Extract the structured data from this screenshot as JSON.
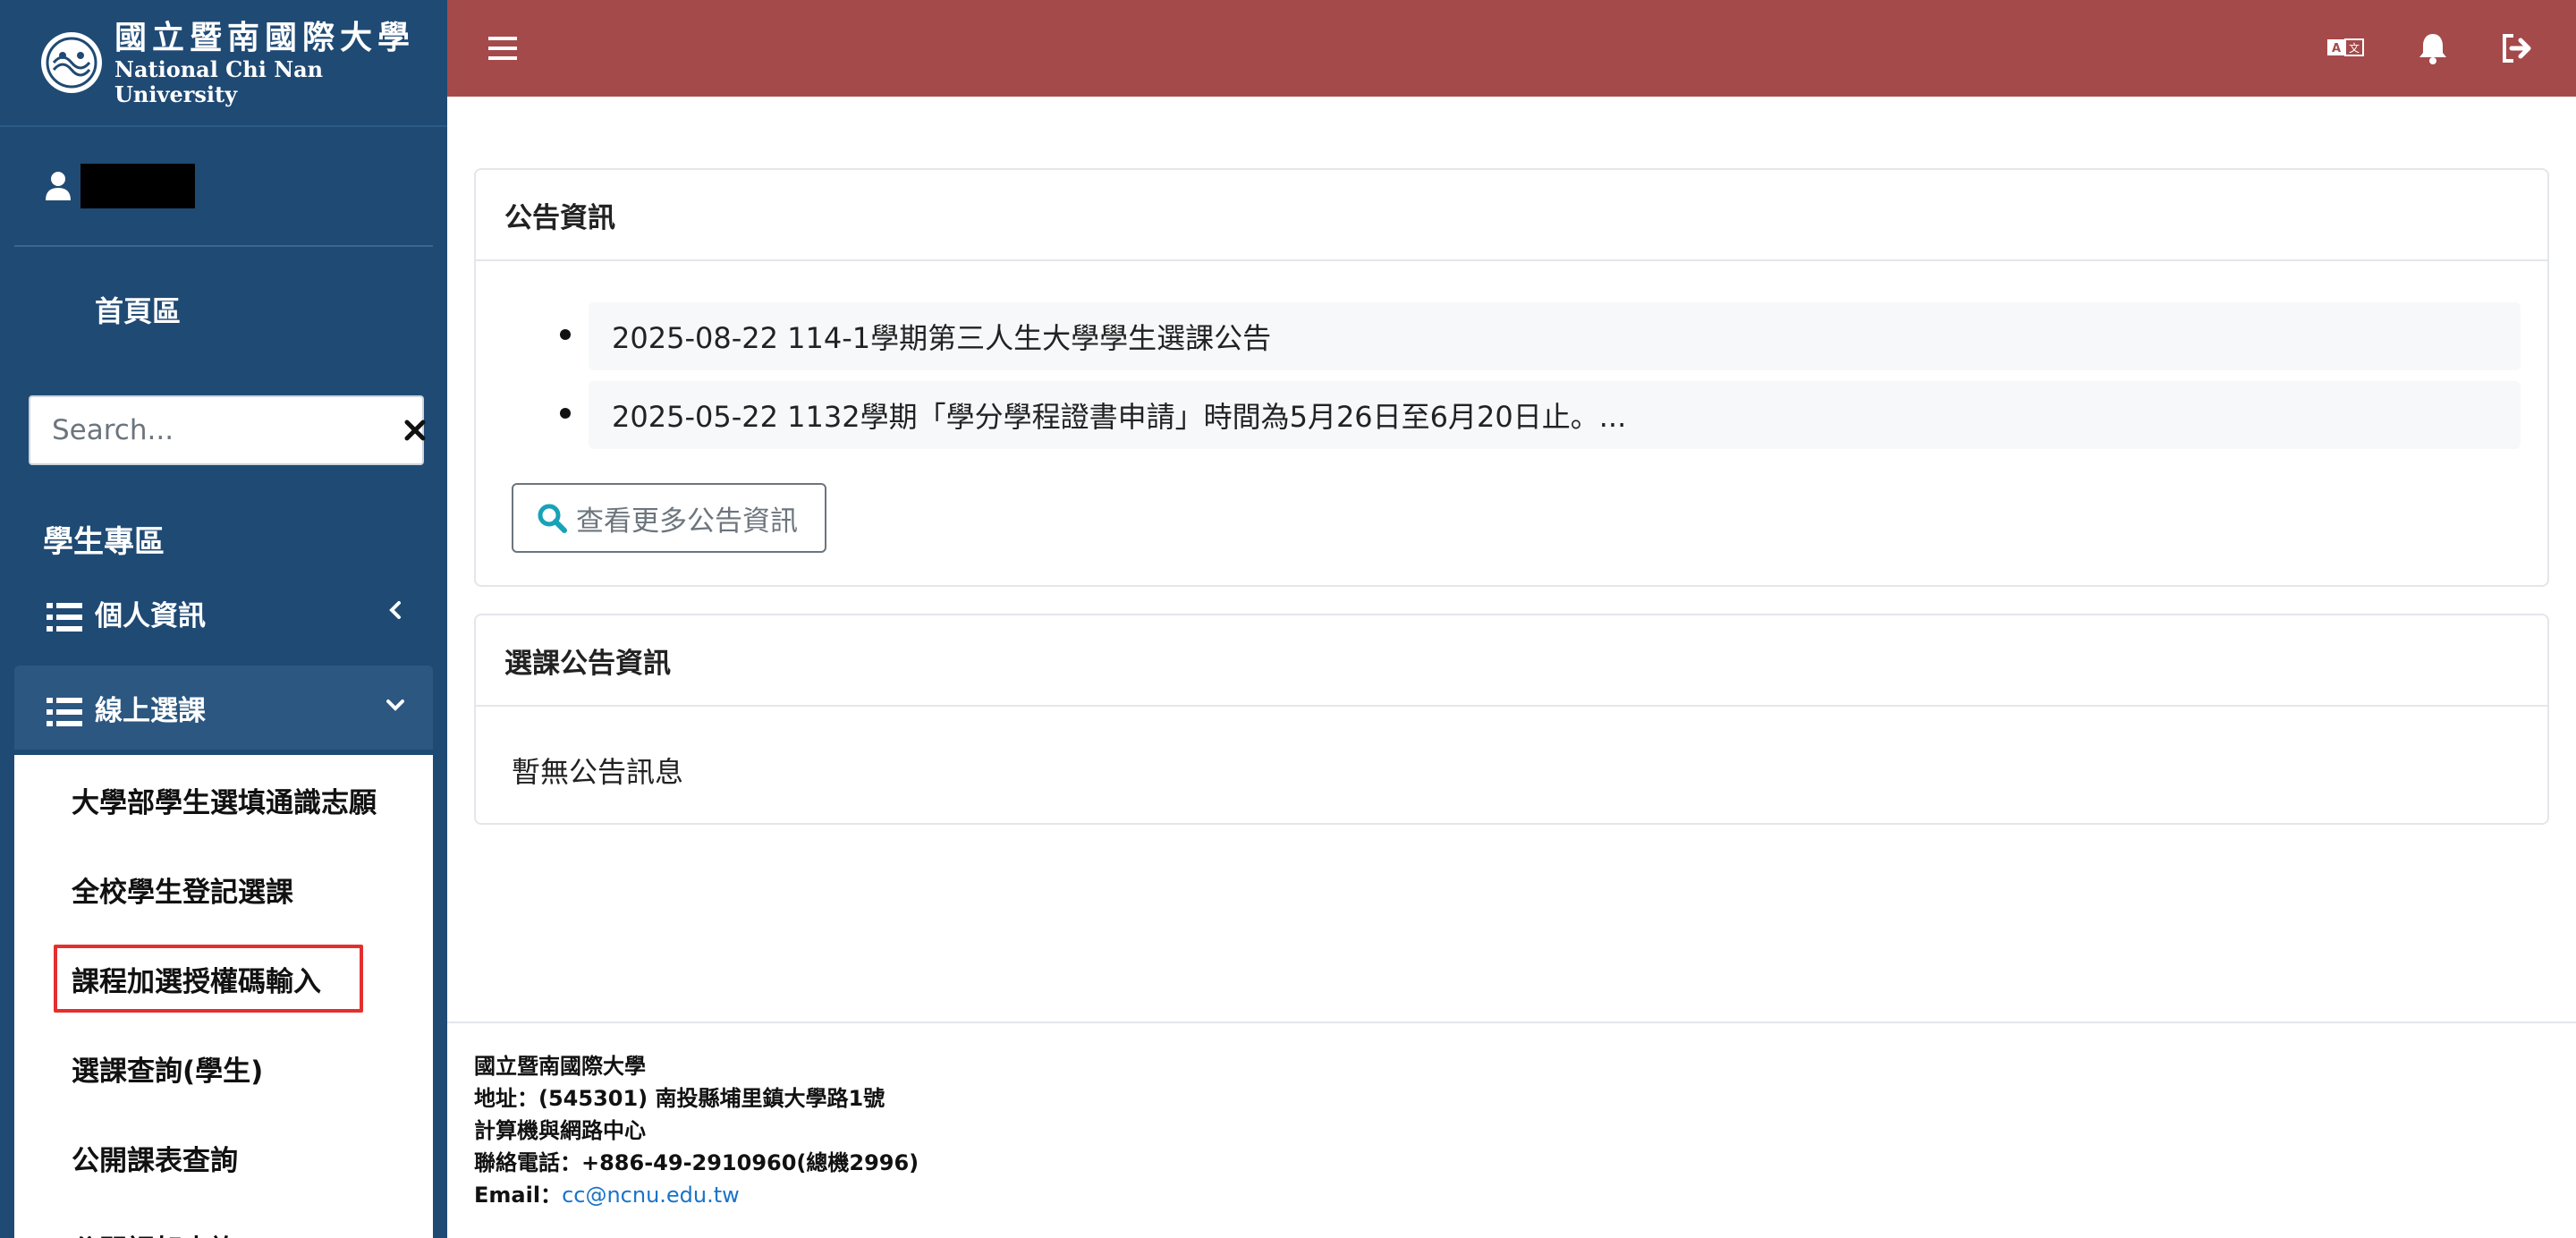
{
  "brand": {
    "name_zh": "國立暨南國際大學",
    "name_en": "National Chi Nan University"
  },
  "sidebar": {
    "home_label": "首頁區",
    "search_placeholder": "Search...",
    "section_title": "學生專區",
    "menu": [
      {
        "label": "個人資訊",
        "expanded": false
      },
      {
        "label": "線上選課",
        "expanded": true
      }
    ],
    "submenu": [
      {
        "label": "大學部學生選填通識志願"
      },
      {
        "label": "全校學生登記選課"
      },
      {
        "label": "課程加選授權碼輸入",
        "highlighted": true
      },
      {
        "label": "選課查詢(學生)"
      },
      {
        "label": "公開課表查詢"
      },
      {
        "label": "公開課架查詢"
      }
    ]
  },
  "topbar": {
    "icons": [
      "menu-icon",
      "translate-icon",
      "bell-icon",
      "logout-icon"
    ],
    "color": "#a54a4a"
  },
  "announcements": {
    "title": "公告資訊",
    "items": [
      {
        "text": "2025-08-22 114-1學期第三人生大學學生選課公告"
      },
      {
        "text": "2025-05-22 1132學期「學分學程證書申請」時間為5月26日至6月20日止。..."
      }
    ],
    "more_button": "查看更多公告資訊"
  },
  "course_announcements": {
    "title": "選課公告資訊",
    "empty_text": "暫無公告訊息"
  },
  "footer": {
    "name": "國立暨南國際大學",
    "address": "地址：(545301) 南投縣埔里鎮大學路1號",
    "unit": "計算機與網路中心",
    "phone": "聯絡電話：+886-49-2910960(總機2996)",
    "email_label": "Email：",
    "email": "cc@ncnu.edu.tw"
  },
  "colors": {
    "sidebar_bg": "#1f4a74",
    "highlight_box": "#e42f2f",
    "link": "#1a73c8"
  }
}
